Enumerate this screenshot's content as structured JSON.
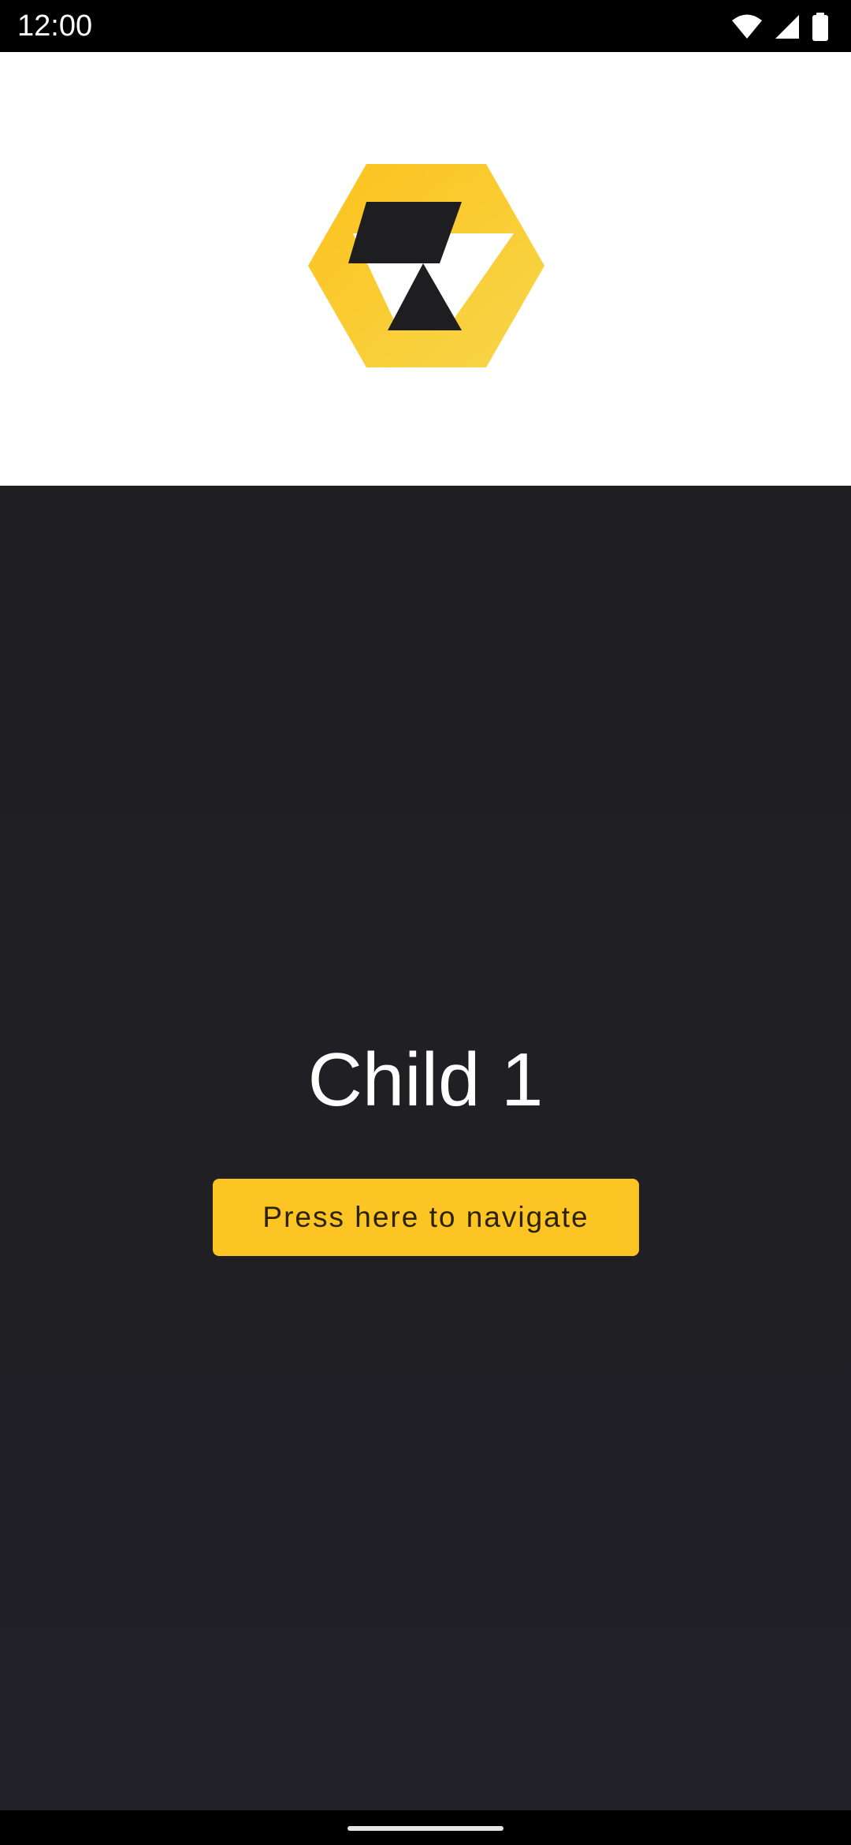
{
  "status_bar": {
    "time": "12:00",
    "icons": [
      "wifi-icon",
      "cell-signal-icon",
      "battery-icon"
    ]
  },
  "header": {
    "logo": "hexagon-logo",
    "logo_colors": {
      "yellow": "#fcc524",
      "dark": "#1e1e20"
    }
  },
  "main": {
    "title": "Child 1",
    "button_label": "Press here to navigate"
  },
  "theme": {
    "accent": "#fcc524",
    "background": "#1f1f22",
    "header_background": "#ffffff"
  }
}
